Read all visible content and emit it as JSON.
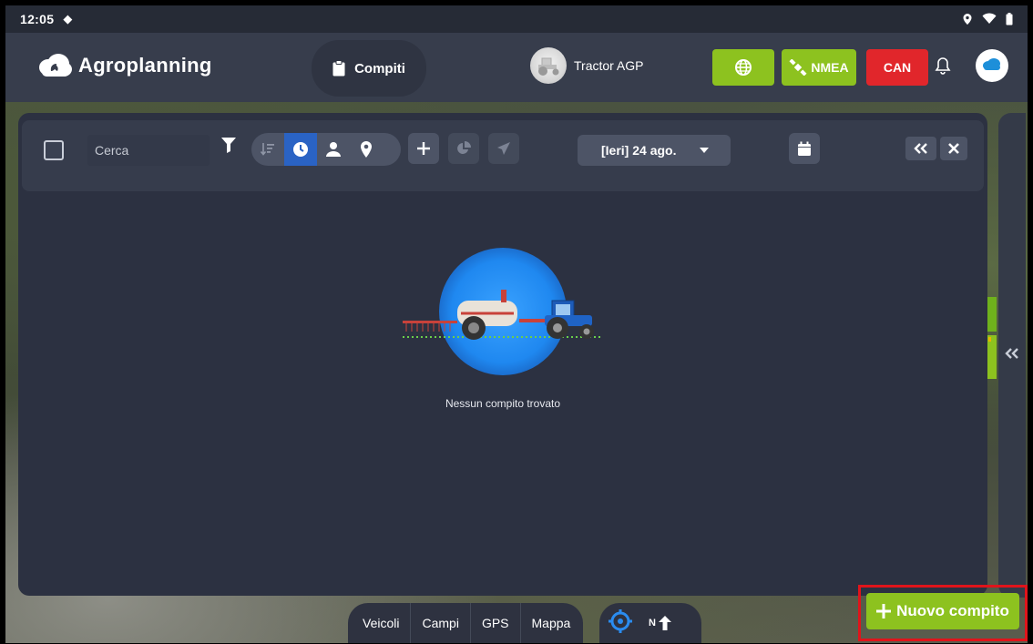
{
  "statusbar": {
    "time": "12:05"
  },
  "header": {
    "brand": "Agroplanning",
    "tab_label": "Compiti",
    "vehicle_name": "Tractor AGP",
    "nmea_label": "NMEA",
    "can_label": "CAN"
  },
  "toolbar": {
    "search_placeholder": "Cerca",
    "date_label": "[Ieri] 24 ago."
  },
  "main": {
    "empty_text": "Nessun compito trovato"
  },
  "bottom_nav": {
    "items": [
      "Veicoli",
      "Campi",
      "GPS",
      "Mappa"
    ],
    "north_label": "N"
  },
  "actions": {
    "new_task_label": "Nuovo compito"
  },
  "colors": {
    "accent_green": "#8dc21f",
    "can_red": "#e1262b",
    "active_blue": "#2a63c4",
    "highlight_red": "#e0141b"
  }
}
